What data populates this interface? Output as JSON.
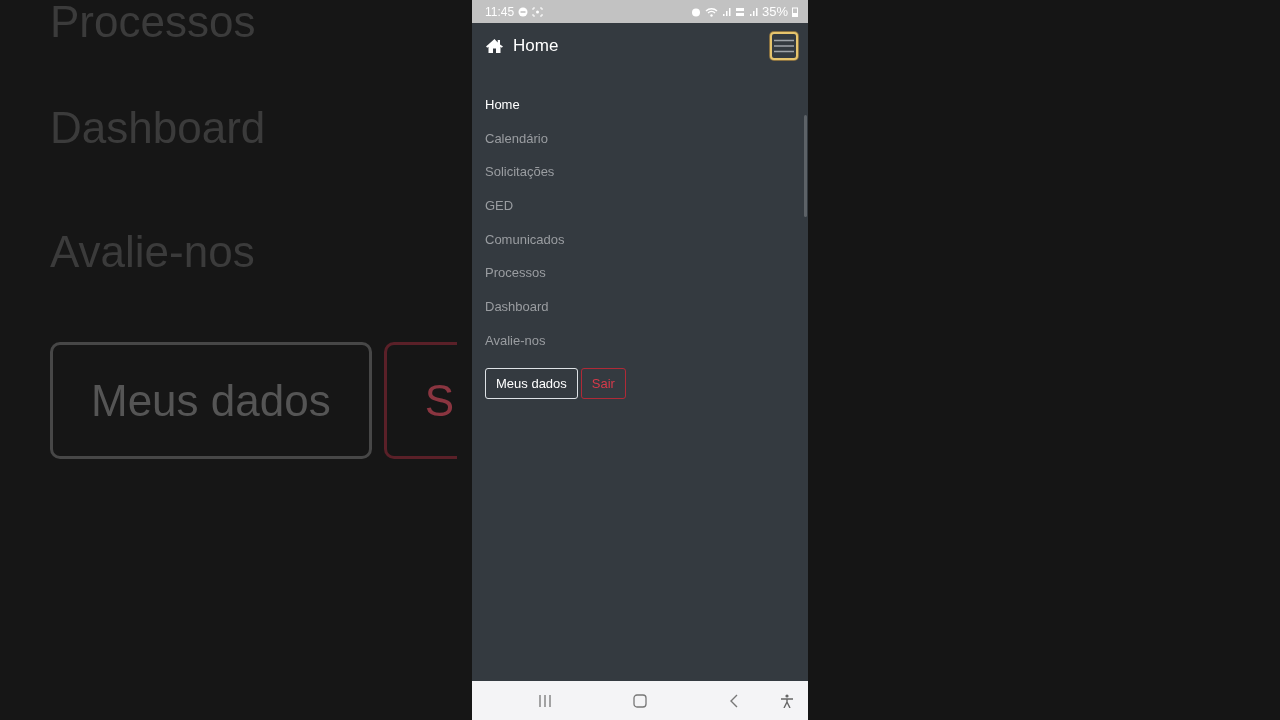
{
  "backdrop": {
    "items": [
      "Processos",
      "Dashboard",
      "Avalie-nos"
    ],
    "buttons": [
      {
        "label": "Meus dados",
        "kind": "outline-light"
      },
      {
        "label": "S",
        "kind": "outline-danger"
      }
    ]
  },
  "status_bar": {
    "time": "11:45",
    "battery": "35%"
  },
  "navbar": {
    "brand": "Home",
    "toggler_focused": true
  },
  "menu": {
    "items": [
      {
        "label": "Home",
        "selected": true
      },
      {
        "label": "Calendário",
        "selected": false
      },
      {
        "label": "Solicitações",
        "selected": false
      },
      {
        "label": "GED",
        "selected": false
      },
      {
        "label": "Comunicados",
        "selected": false
      },
      {
        "label": "Processos",
        "selected": false
      },
      {
        "label": "Dashboard",
        "selected": false
      },
      {
        "label": "Avalie-nos",
        "selected": false
      }
    ],
    "buttons": [
      {
        "label": "Meus dados",
        "kind": "outline-light"
      },
      {
        "label": "Sair",
        "kind": "outline-danger"
      }
    ]
  }
}
